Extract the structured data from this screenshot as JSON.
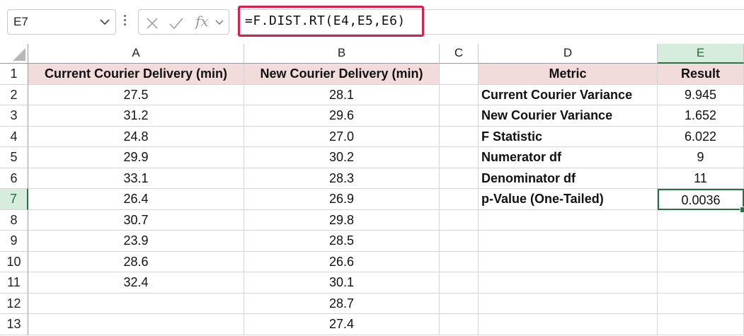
{
  "namebox": {
    "value": "E7"
  },
  "formula": {
    "value": "=F.DIST.RT(E4,E5,E6)"
  },
  "icons": {
    "cancel": "x-icon",
    "enter": "check-icon",
    "function": "fx-icon"
  },
  "fx_label": "fx",
  "columns": [
    "A",
    "B",
    "C",
    "D",
    "E"
  ],
  "rows": [
    "1",
    "2",
    "3",
    "4",
    "5",
    "6",
    "7",
    "8",
    "9",
    "10",
    "11",
    "12",
    "13"
  ],
  "table1": {
    "header_a": "Current Courier Delivery (min)",
    "header_b": "New Courier Delivery (min)",
    "col_a": [
      "27.5",
      "31.2",
      "24.8",
      "29.9",
      "33.1",
      "26.4",
      "30.7",
      "23.9",
      "28.6",
      "32.4",
      "",
      ""
    ],
    "col_b": [
      "28.1",
      "29.6",
      "27.0",
      "30.2",
      "28.3",
      "26.9",
      "29.8",
      "28.5",
      "26.6",
      "30.1",
      "28.7",
      "27.4"
    ]
  },
  "table2": {
    "header_metric": "Metric",
    "header_result": "Result",
    "metrics": [
      "Current Courier Variance",
      "New Courier Variance",
      "F Statistic",
      "Numerator df",
      "Denominator df",
      "p-Value (One-Tailed)"
    ],
    "results": [
      "9.945",
      "1.652",
      "6.022",
      "9",
      "11",
      "0.0036"
    ]
  },
  "colors": {
    "accent": "#217346",
    "highlight_border": "#d6204e",
    "header_fill": "#f2dcdb"
  }
}
